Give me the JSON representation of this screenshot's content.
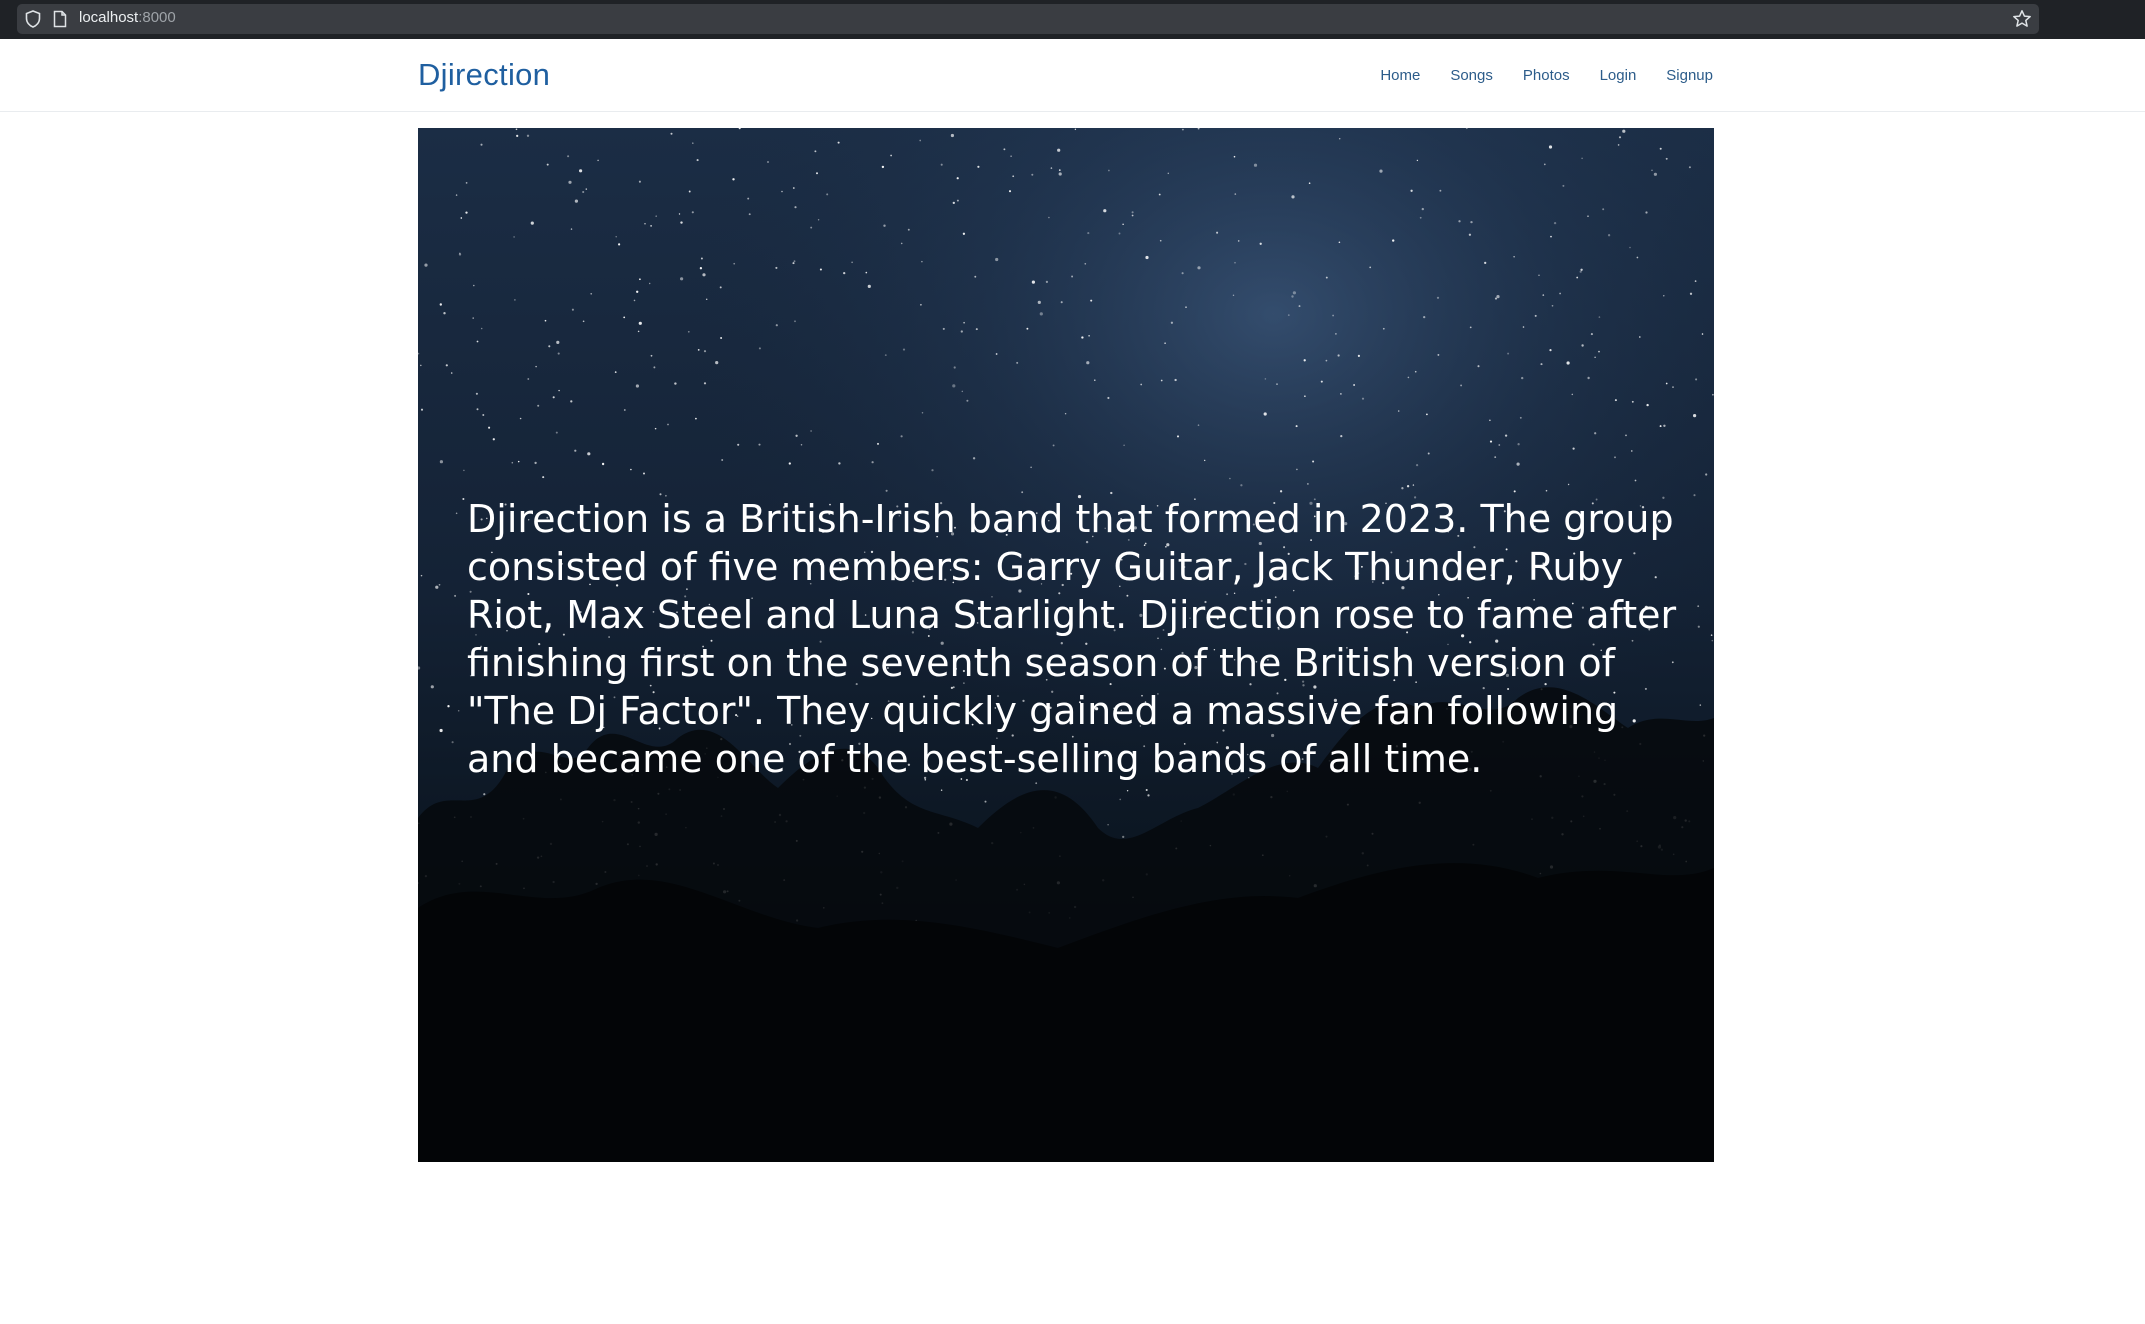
{
  "browser": {
    "url_host": "localhost",
    "url_port": ":8000",
    "icons": [
      "shield-icon",
      "page-icon",
      "star-icon"
    ]
  },
  "header": {
    "brand": "Djirection",
    "nav": {
      "home": "Home",
      "songs": "Songs",
      "photos": "Photos",
      "login": "Login",
      "signup": "Signup"
    }
  },
  "hero": {
    "text": "Djirection is a British-Irish band that formed in 2023. The group consisted of five members: Garry Guitar, Jack Thunder, Ruby Riot, Max Steel and Luna Starlight. Djirection rose to fame after finishing first on the seventh season of the British version of \"The Dj Factor\". They quickly gained a massive fan following and became one of the best-selling bands of all time."
  },
  "colors": {
    "brand": "#1f5fa0",
    "nav_link": "#2c5c8a",
    "browser_chrome": "#1f2226",
    "url_field": "#3a3d42",
    "sky_top": "#1b2d45",
    "sky_bottom": "#05080c"
  }
}
